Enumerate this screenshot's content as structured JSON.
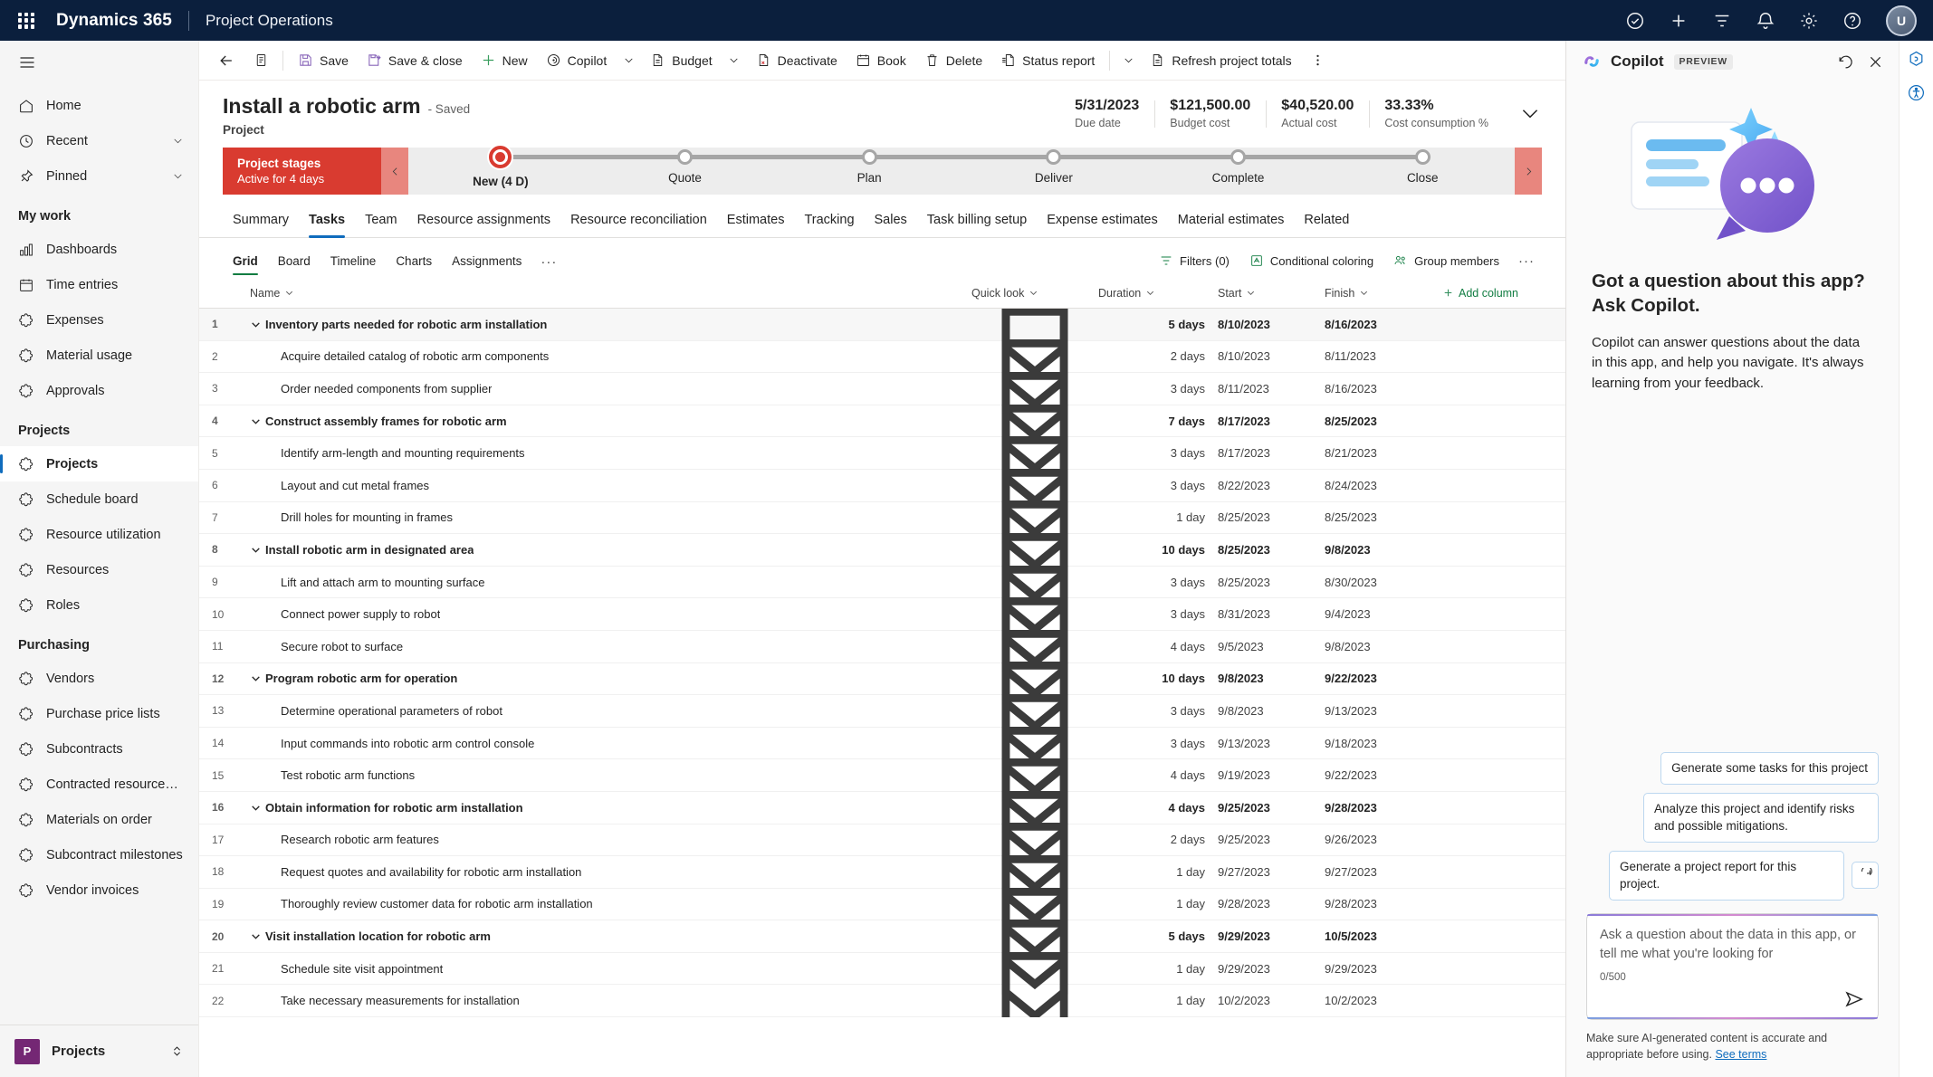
{
  "topbar": {
    "waffle_name": "app-launcher",
    "brand": "Dynamics 365",
    "app_name": "Project Operations",
    "icons": [
      "check-circle-icon",
      "plus-icon",
      "filter-icon",
      "bell-icon",
      "gear-icon",
      "help-icon"
    ],
    "avatar_initials": "U"
  },
  "sidebar": {
    "hamburger": "menu-icon",
    "top_items": [
      {
        "label": "Home",
        "icon": "home-icon",
        "chevron": false
      },
      {
        "label": "Recent",
        "icon": "clock-icon",
        "chevron": true
      },
      {
        "label": "Pinned",
        "icon": "pin-icon",
        "chevron": true
      }
    ],
    "groups": [
      {
        "title": "My work",
        "items": [
          {
            "label": "Dashboards",
            "icon": "dashboard-icon"
          },
          {
            "label": "Time entries",
            "icon": "calendar-icon"
          },
          {
            "label": "Expenses",
            "icon": "entity-icon"
          },
          {
            "label": "Material usage",
            "icon": "entity-icon"
          },
          {
            "label": "Approvals",
            "icon": "entity-icon"
          }
        ]
      },
      {
        "title": "Projects",
        "items": [
          {
            "label": "Projects",
            "icon": "entity-icon",
            "active": true
          },
          {
            "label": "Schedule board",
            "icon": "entity-icon"
          },
          {
            "label": "Resource utilization",
            "icon": "entity-icon"
          },
          {
            "label": "Resources",
            "icon": "entity-icon"
          },
          {
            "label": "Roles",
            "icon": "entity-icon"
          }
        ]
      },
      {
        "title": "Purchasing",
        "items": [
          {
            "label": "Vendors",
            "icon": "entity-icon"
          },
          {
            "label": "Purchase price lists",
            "icon": "entity-icon"
          },
          {
            "label": "Subcontracts",
            "icon": "entity-icon"
          },
          {
            "label": "Contracted resource…",
            "icon": "entity-icon"
          },
          {
            "label": "Materials on order",
            "icon": "entity-icon"
          },
          {
            "label": "Subcontract milestones",
            "icon": "entity-icon"
          },
          {
            "label": "Vendor invoices",
            "icon": "entity-icon"
          }
        ]
      }
    ],
    "footer": {
      "badge": "P",
      "label": "Projects",
      "chevron": "chevron-updown-icon"
    }
  },
  "commandbar": {
    "back": "back-arrow-icon",
    "form_selector": "form-icon",
    "items": [
      {
        "label": "Save",
        "icon": "save-icon"
      },
      {
        "label": "Save & close",
        "icon": "save-close-icon"
      },
      {
        "label": "New",
        "icon": "plus-icon"
      },
      {
        "label": "Copilot",
        "icon": "copilot-icon"
      }
    ],
    "budget": {
      "label": "Budget",
      "icon": "document-icon"
    },
    "items2": [
      {
        "label": "Deactivate",
        "icon": "deactivate-icon"
      },
      {
        "label": "Book",
        "icon": "calendar-icon"
      },
      {
        "label": "Delete",
        "icon": "trash-icon"
      },
      {
        "label": "Status report",
        "icon": "status-report-icon"
      }
    ],
    "refresh": {
      "label": "Refresh project totals",
      "icon": "document-icon"
    },
    "overflow": "more-vertical-icon"
  },
  "record": {
    "title": "Install a robotic arm",
    "saved_state": "- Saved",
    "subtitle": "Project",
    "metrics": [
      {
        "value": "5/31/2023",
        "label": "Due date"
      },
      {
        "value": "$121,500.00",
        "label": "Budget cost"
      },
      {
        "value": "$40,520.00",
        "label": "Actual cost"
      },
      {
        "value": "33.33%",
        "label": "Cost consumption %"
      }
    ],
    "expand_icon": "chevron-down-icon"
  },
  "bpf": {
    "tag_title": "Project stages",
    "tag_subtitle": "Active for 4 days",
    "prev_icon": "chevron-left-icon",
    "next_icon": "chevron-right-icon",
    "stages": [
      {
        "name": "New (4 D)",
        "current": true
      },
      {
        "name": "Quote",
        "current": false
      },
      {
        "name": "Plan",
        "current": false
      },
      {
        "name": "Deliver",
        "current": false
      },
      {
        "name": "Complete",
        "current": false
      },
      {
        "name": "Close",
        "current": false
      }
    ]
  },
  "tabs": [
    {
      "label": "Summary",
      "active": false
    },
    {
      "label": "Tasks",
      "active": true
    },
    {
      "label": "Team",
      "active": false
    },
    {
      "label": "Resource assignments",
      "active": false
    },
    {
      "label": "Resource reconciliation",
      "active": false
    },
    {
      "label": "Estimates",
      "active": false
    },
    {
      "label": "Tracking",
      "active": false
    },
    {
      "label": "Sales",
      "active": false
    },
    {
      "label": "Task billing setup",
      "active": false
    },
    {
      "label": "Expense estimates",
      "active": false
    },
    {
      "label": "Material estimates",
      "active": false
    },
    {
      "label": "Related",
      "active": false
    }
  ],
  "subtabs": [
    {
      "label": "Grid",
      "active": true
    },
    {
      "label": "Board",
      "active": false
    },
    {
      "label": "Timeline",
      "active": false
    },
    {
      "label": "Charts",
      "active": false
    },
    {
      "label": "Assignments",
      "active": false
    }
  ],
  "subtabs_more": "···",
  "gridtools": [
    {
      "label": "Filters (0)",
      "icon": "filter-icon"
    },
    {
      "label": "Conditional coloring",
      "icon": "coloring-icon"
    },
    {
      "label": "Group members",
      "icon": "group-members-icon"
    }
  ],
  "gridtools_more": "···",
  "grid": {
    "columns": [
      {
        "key": "name",
        "label": "Name"
      },
      {
        "key": "quick",
        "label": "Quick look"
      },
      {
        "key": "duration",
        "label": "Duration"
      },
      {
        "key": "start",
        "label": "Start"
      },
      {
        "key": "finish",
        "label": "Finish"
      }
    ],
    "add_column": "Add column",
    "quicklook_icon": "quick-look-icon",
    "expand_icon": "chevron-down-small-icon",
    "rows": [
      {
        "num": "1",
        "name": "Inventory parts needed for robotic arm installation",
        "summary": true,
        "selected": true,
        "duration": "5 days",
        "start": "8/10/2023",
        "finish": "8/16/2023"
      },
      {
        "num": "2",
        "name": "Acquire detailed catalog of robotic arm components",
        "summary": false,
        "selected": false,
        "duration": "2 days",
        "start": "8/10/2023",
        "finish": "8/11/2023"
      },
      {
        "num": "3",
        "name": "Order needed components from supplier",
        "summary": false,
        "selected": false,
        "duration": "3 days",
        "start": "8/11/2023",
        "finish": "8/16/2023"
      },
      {
        "num": "4",
        "name": "Construct assembly frames for robotic arm",
        "summary": true,
        "selected": false,
        "duration": "7 days",
        "start": "8/17/2023",
        "finish": "8/25/2023"
      },
      {
        "num": "5",
        "name": "Identify arm-length and mounting requirements",
        "summary": false,
        "selected": false,
        "duration": "3 days",
        "start": "8/17/2023",
        "finish": "8/21/2023"
      },
      {
        "num": "6",
        "name": "Layout and cut metal frames",
        "summary": false,
        "selected": false,
        "duration": "3 days",
        "start": "8/22/2023",
        "finish": "8/24/2023"
      },
      {
        "num": "7",
        "name": "Drill holes for mounting in frames",
        "summary": false,
        "selected": false,
        "duration": "1 day",
        "start": "8/25/2023",
        "finish": "8/25/2023"
      },
      {
        "num": "8",
        "name": "Install robotic arm in designated area",
        "summary": true,
        "selected": false,
        "duration": "10 days",
        "start": "8/25/2023",
        "finish": "9/8/2023"
      },
      {
        "num": "9",
        "name": "Lift and attach arm to mounting surface",
        "summary": false,
        "selected": false,
        "duration": "3 days",
        "start": "8/25/2023",
        "finish": "8/30/2023"
      },
      {
        "num": "10",
        "name": "Connect power supply to robot",
        "summary": false,
        "selected": false,
        "duration": "3 days",
        "start": "8/31/2023",
        "finish": "9/4/2023"
      },
      {
        "num": "11",
        "name": "Secure robot to surface",
        "summary": false,
        "selected": false,
        "duration": "4 days",
        "start": "9/5/2023",
        "finish": "9/8/2023"
      },
      {
        "num": "12",
        "name": "Program robotic arm for operation",
        "summary": true,
        "selected": false,
        "duration": "10 days",
        "start": "9/8/2023",
        "finish": "9/22/2023"
      },
      {
        "num": "13",
        "name": "Determine operational parameters of robot",
        "summary": false,
        "selected": false,
        "duration": "3 days",
        "start": "9/8/2023",
        "finish": "9/13/2023"
      },
      {
        "num": "14",
        "name": "Input commands into robotic arm control console",
        "summary": false,
        "selected": false,
        "duration": "3 days",
        "start": "9/13/2023",
        "finish": "9/18/2023"
      },
      {
        "num": "15",
        "name": "Test robotic arm functions",
        "summary": false,
        "selected": false,
        "duration": "4 days",
        "start": "9/19/2023",
        "finish": "9/22/2023"
      },
      {
        "num": "16",
        "name": "Obtain information for robotic arm installation",
        "summary": true,
        "selected": false,
        "duration": "4 days",
        "start": "9/25/2023",
        "finish": "9/28/2023"
      },
      {
        "num": "17",
        "name": "Research robotic arm features",
        "summary": false,
        "selected": false,
        "duration": "2 days",
        "start": "9/25/2023",
        "finish": "9/26/2023"
      },
      {
        "num": "18",
        "name": "Request quotes and availability for robotic arm installation",
        "summary": false,
        "selected": false,
        "duration": "1 day",
        "start": "9/27/2023",
        "finish": "9/27/2023"
      },
      {
        "num": "19",
        "name": "Thoroughly review customer data for robotic arm installation",
        "summary": false,
        "selected": false,
        "duration": "1 day",
        "start": "9/28/2023",
        "finish": "9/28/2023"
      },
      {
        "num": "20",
        "name": "Visit installation location for robotic arm",
        "summary": true,
        "selected": false,
        "duration": "5 days",
        "start": "9/29/2023",
        "finish": "10/5/2023"
      },
      {
        "num": "21",
        "name": "Schedule site visit appointment",
        "summary": false,
        "selected": false,
        "duration": "1 day",
        "start": "9/29/2023",
        "finish": "9/29/2023"
      },
      {
        "num": "22",
        "name": "Take necessary measurements for installation",
        "summary": false,
        "selected": false,
        "duration": "1 day",
        "start": "10/2/2023",
        "finish": "10/2/2023"
      }
    ]
  },
  "copilot": {
    "title": "Copilot",
    "preview_badge": "PREVIEW",
    "refresh_icon": "history-icon",
    "close_icon": "close-icon",
    "headline": "Got a question about this app? Ask Copilot.",
    "description": "Copilot can answer questions about the data in this app, and help you navigate. It's always learning from your feedback.",
    "suggestions": [
      "Generate some tasks for this project",
      "Analyze this project and identify risks and possible mitigations.",
      "Generate a project report for this project."
    ],
    "suggest_refresh_icon": "refresh-icon",
    "input_placeholder": "Ask a question about the data in this app, or tell me what you're looking for",
    "char_counter": "0/500",
    "send_icon": "send-icon",
    "disclaimer": "Make sure AI-generated content is accurate and appropriate before using.",
    "disclaimer_link": "See terms"
  },
  "rail": {
    "icons": [
      "copilot-badge-icon",
      "accessibility-icon"
    ]
  },
  "colors": {
    "topbar_bg": "#0b1f3d",
    "accent_blue": "#0f6cbd",
    "bpf_red": "#d93b30",
    "green": "#107c41",
    "purple": "#742774"
  }
}
